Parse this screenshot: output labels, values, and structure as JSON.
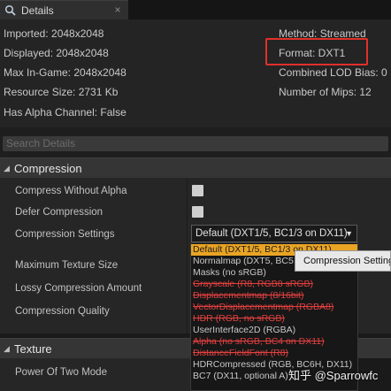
{
  "tab": {
    "label": "Details",
    "icon": "magnifier-icon",
    "close": "×"
  },
  "info": {
    "imported": "Imported: 2048x2048",
    "displayed": "Displayed: 2048x2048",
    "max_in_game": "Max In-Game: 2048x2048",
    "resource_size": "Resource Size: 2731 Kb",
    "has_alpha": "Has Alpha Channel: False",
    "method": "Method: Streamed",
    "format": "Format: DXT1",
    "combined_lod_bias": "Combined LOD Bias: 0",
    "num_mips": "Number of Mips: 12"
  },
  "search": {
    "placeholder": "Search Details"
  },
  "compression": {
    "header": "Compression",
    "compress_without_alpha": "Compress Without Alpha",
    "defer_compression": "Defer Compression",
    "compression_settings": "Compression Settings",
    "max_texture_size": "Maximum Texture Size",
    "lossy_compression_amount": "Lossy Compression Amount",
    "compression_quality": "Compression Quality",
    "selected_value": "Default (DXT1/5, BC1/3 on DX11)"
  },
  "dropdown_options": [
    "Default (DXT1/5, BC1/3 on DX11)",
    "Normalmap (DXT5, BC5 on DX11)",
    "Masks (no sRGB)",
    "Grayscale (R8, RGB8 sRGB)",
    "Displacementmap (8/16bit)",
    "VectorDisplacementmap (RGBA8)",
    "HDR (RGB, no sRGB)",
    "UserInterface2D (RGBA)",
    "Alpha (no sRGB, BC4 on DX11)",
    "DistanceFieldFont (R8)",
    "HDRCompressed (RGB, BC6H, DX11)",
    "BC7 (DX11, optional A)"
  ],
  "tooltip": "Compression Settings",
  "texture": {
    "header": "Texture",
    "power_of_two_mode": "Power Of Two Mode"
  },
  "watermark": "知乎 @Sparrowfc",
  "colors": {
    "highlight": "#e0302a",
    "selected_item": "#e9a424",
    "strike_item": "#e24040"
  }
}
